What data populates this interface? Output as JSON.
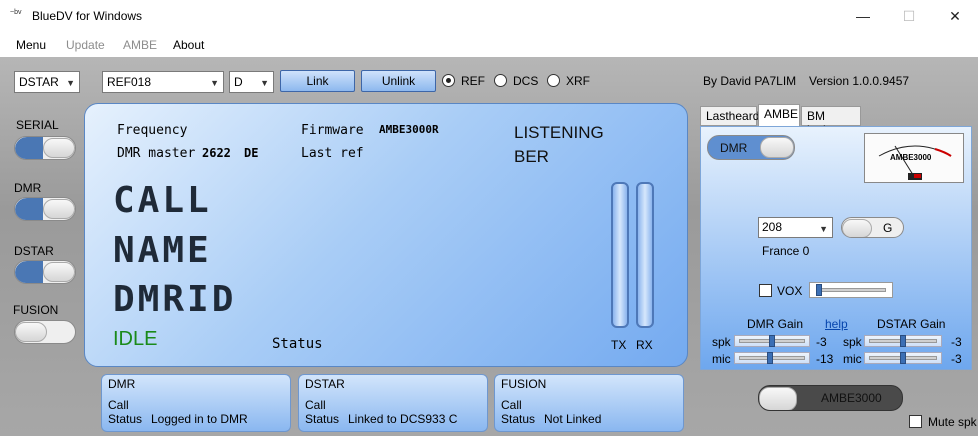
{
  "window": {
    "title": "BlueDV for Windows",
    "icon_text": "~bv",
    "minimize": "—",
    "maximize": "☐",
    "close": "✕"
  },
  "menu": [
    "Menu",
    "Update",
    "AMBE",
    "About"
  ],
  "toolbar": {
    "mode_select": "DSTAR",
    "reflector_select": "REF018",
    "module_select": "D",
    "link_label": "Link",
    "unlink_label": "Unlink",
    "radio_ref": "REF",
    "radio_dcs": "DCS",
    "radio_xrf": "XRF",
    "author": "By David PA7LIM",
    "version": "Version 1.0.0.9457"
  },
  "left_toggles": [
    "SERIAL",
    "DMR",
    "DSTAR",
    "FUSION"
  ],
  "display": {
    "frequency_label": "Frequency",
    "dmr_master_label": "DMR master",
    "dmr_master_value": "2622",
    "dmr_master_country": "DE",
    "firmware_label": "Firmware",
    "firmware_value": "AMBE3000R",
    "last_ref_label": "Last ref",
    "listening": "LISTENING",
    "ber": "BER",
    "call": "CALL",
    "name": "NAME",
    "dmrid": "DMRID",
    "state": "IDLE",
    "status_label": "Status",
    "tx_label": "TX",
    "rx_label": "RX"
  },
  "bottom_panels": [
    {
      "title": "DMR",
      "call_label": "Call",
      "status_label": "Status",
      "status_value": "Logged in to DMR"
    },
    {
      "title": "DSTAR",
      "call_label": "Call",
      "status_label": "Status",
      "status_value": "Linked to DCS933 C"
    },
    {
      "title": "FUSION",
      "call_label": "Call",
      "status_label": "Status",
      "status_value": "Not Linked"
    }
  ],
  "tabs": [
    "Lastheard",
    "AMBE",
    "BM lookup"
  ],
  "ambe": {
    "dmr_toggle": "DMR",
    "meter_label": "AMBE3000",
    "tg_select": "208",
    "g_button": "G",
    "country": "France 0",
    "vox_label": "VOX",
    "dmr_gain": "DMR Gain",
    "help": "help",
    "dstar_gain": "DSTAR Gain",
    "spk": "spk",
    "mic": "mic",
    "dmr_spk_value": "-3",
    "dmr_mic_value": "-13",
    "dstar_spk_value": "-3",
    "dstar_mic_value": "-3",
    "ambe_button": "AMBE3000",
    "mute_label": "Mute spk"
  },
  "colors": {
    "accent": "#4a77b4",
    "idle": "#1a8a1a",
    "lcd": "#a9cdf6"
  }
}
